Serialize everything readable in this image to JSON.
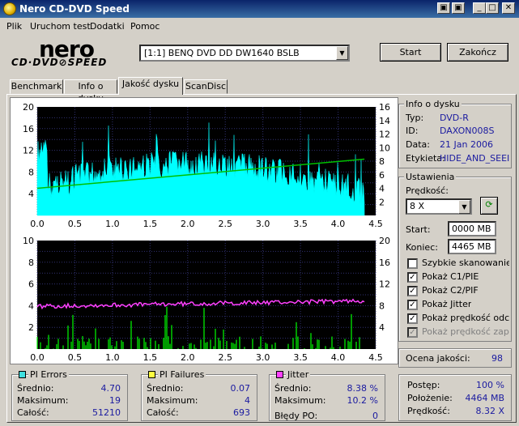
{
  "window": {
    "title": "Nero CD-DVD Speed"
  },
  "menu": [
    "Plik",
    "Uruchom test",
    "Dodatki",
    "Pomoc"
  ],
  "logo": {
    "brand": "nero",
    "sub": "CD·DVD⊘SPEED"
  },
  "drive": {
    "selected": "[1:1]  BENQ DVD DD DW1640 BSLB"
  },
  "buttons": {
    "start": "Start",
    "stop": "Zakończ"
  },
  "tabs": [
    "Benchmark",
    "Info o dysku",
    "Jakość dysku",
    "ScanDisc"
  ],
  "active_tab": "Jakość dysku",
  "disc_info": {
    "title": "Info o dysku",
    "type_label": "Typ:",
    "type": "DVD-R",
    "id_label": "ID:",
    "id": "DAXON008S",
    "date_label": "Data:",
    "date": "21 Jan 2006",
    "label_label": "Etykieta:",
    "label": "HIDE_AND_SEEI"
  },
  "settings": {
    "title": "Ustawienia",
    "speed_label": "Prędkość:",
    "speed": "8 X",
    "start_label": "Start:",
    "start": "0000 MB",
    "end_label": "Koniec:",
    "end": "4465 MB",
    "checkboxes": [
      {
        "label": "Szybkie skanowanie",
        "checked": false
      },
      {
        "label": "Pokaż C1/PIE",
        "checked": true
      },
      {
        "label": "Pokaż C2/PIF",
        "checked": true
      },
      {
        "label": "Pokaż Jitter",
        "checked": true
      },
      {
        "label": "Pokaż prędkość odczyt",
        "checked": true
      },
      {
        "label": "Pokaż prędkość zapisu",
        "checked": true,
        "disabled": true
      }
    ]
  },
  "quality": {
    "label": "Ocena jakości:",
    "value": "98"
  },
  "pi_errors": {
    "title": "PI Errors",
    "color": "#40e0e0",
    "avg_label": "Średnio:",
    "avg": "4.70",
    "max_label": "Maksimum:",
    "max": "19",
    "total_label": "Całość:",
    "total": "51210"
  },
  "pi_failures": {
    "title": "PI Failures",
    "color": "#ffff40",
    "avg_label": "Średnio:",
    "avg": "0.07",
    "max_label": "Maksimum:",
    "max": "4",
    "total_label": "Całość:",
    "total": "693"
  },
  "jitter": {
    "title": "Jitter",
    "color": "#ff40ff",
    "avg_label": "Średnio:",
    "avg": "8.38 %",
    "max_label": "Maksimum:",
    "max": "10.2 %",
    "po_label": "Błędy PO:",
    "po": "0"
  },
  "progress": {
    "progress_label": "Postęp:",
    "progress": "100 %",
    "position_label": "Położenie:",
    "position": "4464 MB",
    "speed_label": "Prędkość:",
    "speed": "8.32 X"
  },
  "chart_data": [
    {
      "type": "area",
      "series": [
        {
          "name": "PI Errors",
          "color": "#00ffff"
        },
        {
          "name": "Read speed",
          "color": "#00c000",
          "start": 4.0,
          "end": 8.3
        }
      ],
      "xlim": [
        0,
        4.5
      ],
      "ylim_left": [
        0,
        20
      ],
      "ylim_right": [
        0,
        16
      ],
      "x_ticks": [
        "0.0",
        "0.5",
        "1.0",
        "1.5",
        "2.0",
        "2.5",
        "3.0",
        "3.5",
        "4.0",
        "4.5"
      ],
      "y_ticks_left": [
        "20",
        "16",
        "12",
        "8",
        "4"
      ],
      "y_ticks_right": [
        "16",
        "14",
        "12",
        "10",
        "8",
        "6",
        "4",
        "2"
      ],
      "pi_max": 19,
      "pi_avg": 4.7
    },
    {
      "type": "bar",
      "series": [
        {
          "name": "PI Failures",
          "color": "#00ff00"
        },
        {
          "name": "Jitter",
          "color": "#ff40ff",
          "mean": 8.38
        }
      ],
      "xlim": [
        0,
        4.5
      ],
      "ylim_left": [
        0,
        10
      ],
      "ylim_right": [
        0,
        20
      ],
      "x_ticks": [
        "0.0",
        "0.5",
        "1.0",
        "1.5",
        "2.0",
        "2.5",
        "3.0",
        "3.5",
        "4.0",
        "4.5"
      ],
      "y_ticks_left": [
        "10",
        "8",
        "6",
        "4",
        "2"
      ],
      "y_ticks_right": [
        "20",
        "16",
        "12",
        "8",
        "4"
      ],
      "pif_max": 4
    }
  ]
}
